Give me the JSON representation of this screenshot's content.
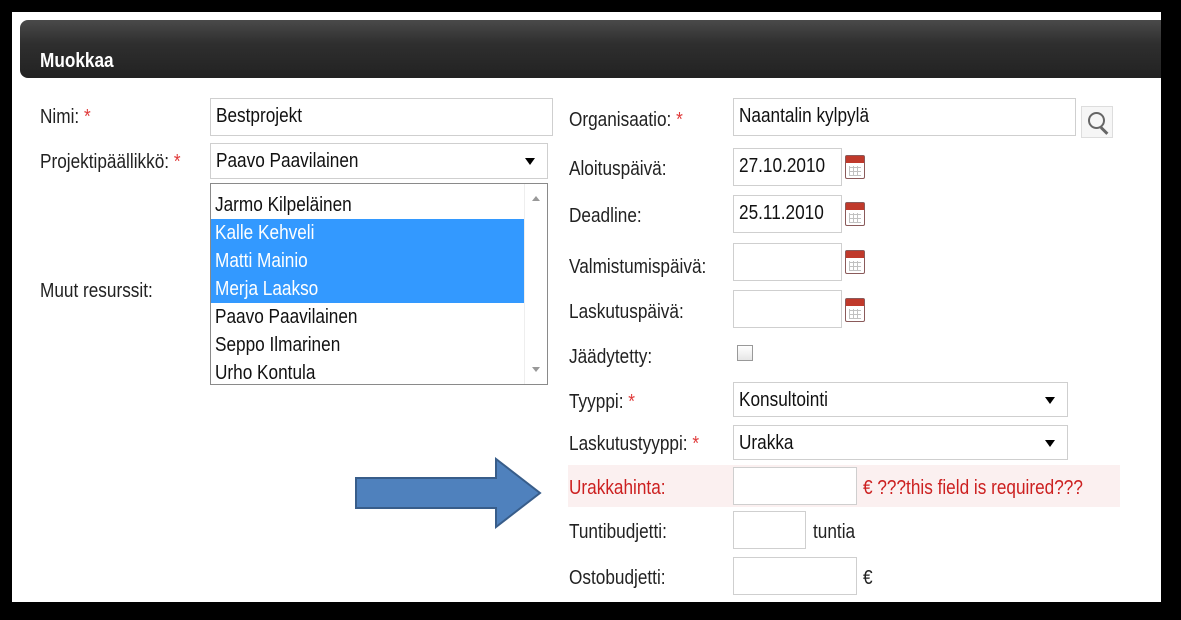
{
  "header": {
    "title": "Muokkaa"
  },
  "fields": {
    "nimi": {
      "label": "Nimi:",
      "required": "*",
      "value": "Bestprojekt"
    },
    "projektipaallikko": {
      "label": "Projektipäällikkö:",
      "required": "*",
      "value": "Paavo Paavilainen"
    },
    "muut_resurssit": {
      "label": "Muut resurssit:",
      "options": [
        {
          "label": "Jarmo Kilpeläinen",
          "selected": false
        },
        {
          "label": "Kalle Kehveli",
          "selected": true
        },
        {
          "label": "Matti Mainio",
          "selected": true
        },
        {
          "label": "Merja Laakso",
          "selected": true
        },
        {
          "label": "Paavo Paavilainen",
          "selected": false
        },
        {
          "label": "Seppo Ilmarinen",
          "selected": false
        },
        {
          "label": "Urho Kontula",
          "selected": false
        }
      ]
    },
    "organisaatio": {
      "label": "Organisaatio:",
      "required": "*",
      "value": "Naantalin kylpylä"
    },
    "aloituspaiva": {
      "label": "Aloituspäivä:",
      "value": "27.10.2010"
    },
    "deadline": {
      "label": "Deadline:",
      "value": "25.11.2010"
    },
    "valmistumispaiva": {
      "label": "Valmistumispäivä:",
      "value": ""
    },
    "laskutuspaiva": {
      "label": "Laskutuspäivä:",
      "value": ""
    },
    "jaadytetty": {
      "label": "Jäädytetty:",
      "checked": false
    },
    "tyyppi": {
      "label": "Tyyppi:",
      "required": "*",
      "value": "Konsultointi"
    },
    "laskutustyyppi": {
      "label": "Laskutustyyppi:",
      "required": "*",
      "value": "Urakka"
    },
    "urakkahinta": {
      "label": "Urakkahinta:",
      "value": "",
      "unit_and_error": "€ ???this field is required???"
    },
    "tuntibudjetti": {
      "label": "Tuntibudjetti:",
      "value": "",
      "unit": "tuntia"
    },
    "ostobudjetti": {
      "label": "Ostobudjetti:",
      "value": "",
      "unit": "€"
    }
  },
  "colors": {
    "header_bg": "#2f2f2f",
    "required": "#e03a3a",
    "error_text": "#cc2020",
    "error_bg": "#fbf0f0",
    "selection": "#3399ff",
    "arrow_fill": "#4f81bd",
    "arrow_stroke": "#385d8a"
  },
  "icons": {
    "calendar": "calendar-icon",
    "search": "search-icon",
    "arrow": "right-arrow-shape"
  }
}
